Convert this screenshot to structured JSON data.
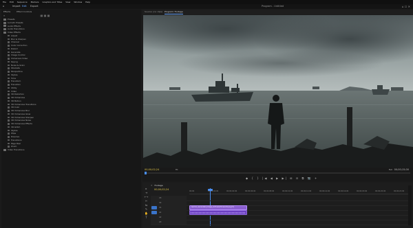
{
  "menu": [
    "File",
    "Edit",
    "Sequence",
    "Markers",
    "Graphics and Titles",
    "View",
    "Window",
    "Help"
  ],
  "workspace": {
    "home_icon": "home-icon",
    "tabs": [
      "Import",
      "Edit",
      "Export"
    ],
    "active": "Edit",
    "program_title": "Program - Untitled"
  },
  "effects_panel": {
    "tabs": [
      "Effects",
      "Effect Controls"
    ],
    "items": [
      {
        "label": "Presets",
        "level": 0
      },
      {
        "label": "Lumetri Presets",
        "level": 0
      },
      {
        "label": "Audio Effects",
        "level": 0
      },
      {
        "label": "Audio Transitions",
        "level": 0
      },
      {
        "label": "Video Effects",
        "level": 0
      },
      {
        "label": "Adjust",
        "level": 1
      },
      {
        "label": "Blur & Sharpen",
        "level": 1
      },
      {
        "label": "Channel",
        "level": 1
      },
      {
        "label": "Color Correction",
        "level": 1
      },
      {
        "label": "Distort",
        "level": 1
      },
      {
        "label": "Generate",
        "level": 1
      },
      {
        "label": "Image Control",
        "level": 1
      },
      {
        "label": "Immersive Video",
        "level": 1
      },
      {
        "label": "Keying",
        "level": 1
      },
      {
        "label": "Noise & Grain",
        "level": 1
      },
      {
        "label": "Obsolete",
        "level": 1
      },
      {
        "label": "Perspective",
        "level": 1
      },
      {
        "label": "Stylize",
        "level": 1
      },
      {
        "label": "Time",
        "level": 1
      },
      {
        "label": "Transform",
        "level": 1
      },
      {
        "label": "Transition",
        "level": 1
      },
      {
        "label": "Utility",
        "level": 1
      },
      {
        "label": "Video",
        "level": 1
      },
      {
        "label": "VR Distortion",
        "level": 1
      },
      {
        "label": "VR Immersive",
        "level": 1
      },
      {
        "label": "VR Motion",
        "level": 1
      },
      {
        "label": "VR Immersive Transitions",
        "level": 1
      },
      {
        "label": "VR Color",
        "level": 1
      },
      {
        "label": "VR Immersive Blur",
        "level": 1
      },
      {
        "label": "VR Immersive Glow",
        "level": 1
      },
      {
        "label": "VR Immersive Sharpen",
        "level": 1
      },
      {
        "label": "VR Immersive Noise",
        "level": 1
      },
      {
        "label": "VR Immersive Effects",
        "level": 1
      },
      {
        "label": "VR Glitch",
        "level": 1
      },
      {
        "label": "Stylize",
        "level": 1
      },
      {
        "label": "Wipe",
        "level": 1
      },
      {
        "label": "Dissolve",
        "level": 1
      },
      {
        "label": "Transitions",
        "level": 1
      },
      {
        "label": "Page Peel",
        "level": 1
      },
      {
        "label": "Zoom",
        "level": 1
      },
      {
        "label": "Video Transitions",
        "level": 0
      }
    ]
  },
  "monitor": {
    "tabs": [
      "Source: (no clips)",
      "Program: Footage"
    ],
    "active_tab": "Program: Footage",
    "timecode_left": "00;00;02;24",
    "fit": "Fit",
    "full_quality": "Full",
    "timecode_right": "00;00;15;00",
    "transport": [
      "◆",
      "{",
      "}",
      "|◀",
      "◀",
      "▶",
      "▶|",
      "⊞",
      "⊟",
      "⧉",
      "📷",
      "+"
    ]
  },
  "timeline": {
    "sequence_name": "Footage",
    "timecode": "00;00;02;24",
    "ruler": [
      "00;00",
      "00;00;02;00",
      "00;00;04;00",
      "00;00;06;00",
      "00;00;08;00",
      "00;00;10;00",
      "00;00;12;00",
      "00;00;14;00",
      "00;00;16;00",
      "00;00;18;00",
      "00;00;20;00",
      "00;00;22;00"
    ],
    "tracks": [
      {
        "name": "V3",
        "type": "video"
      },
      {
        "name": "V2",
        "type": "video"
      },
      {
        "name": "V1",
        "type": "video",
        "clip": "Gemini_Generated_Image_xo3rvwxo3rvwxo3r.png"
      },
      {
        "name": "A1",
        "type": "audio",
        "clip": "Audio"
      },
      {
        "name": "A2",
        "type": "audio"
      },
      {
        "name": "A3",
        "type": "audio"
      }
    ],
    "clip_label": "Gemini_Generated_Image_xo3rvwxo3rvwxo3r.png [V]"
  }
}
